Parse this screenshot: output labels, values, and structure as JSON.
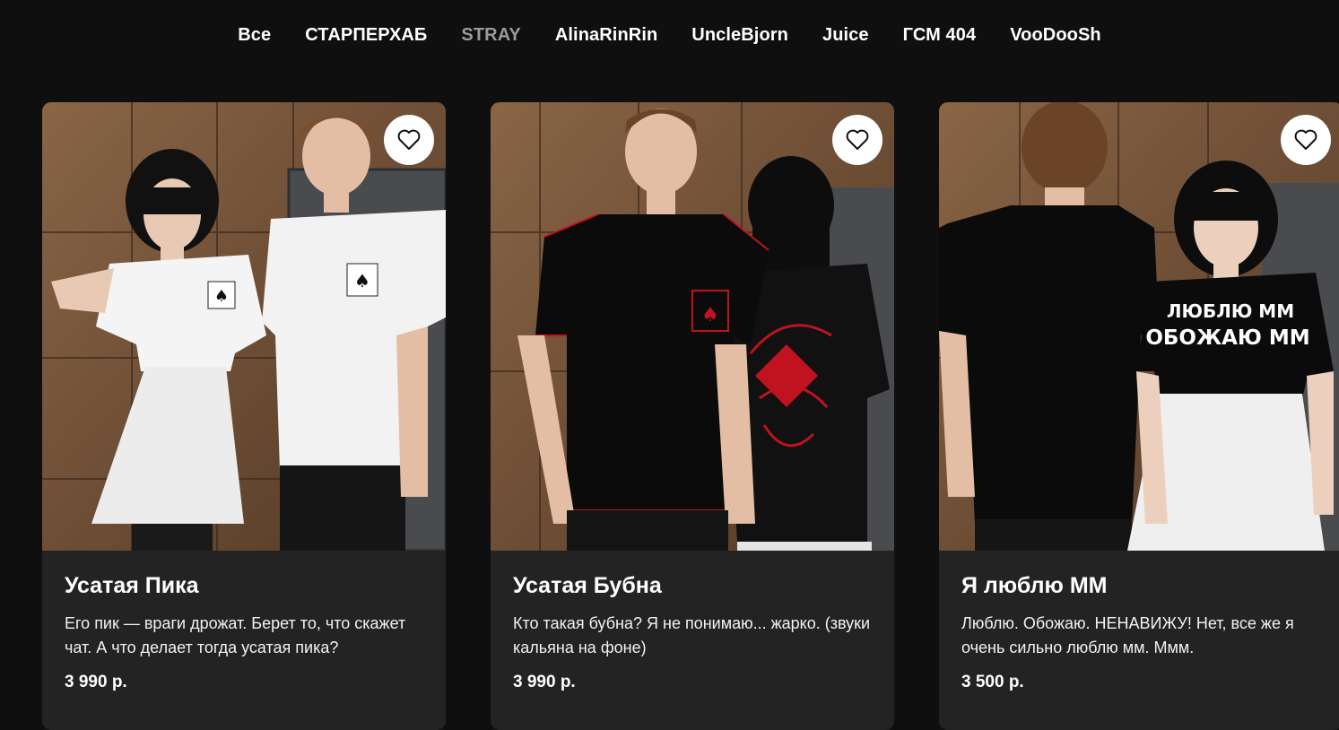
{
  "nav": {
    "items": [
      {
        "label": "Все"
      },
      {
        "label": "СТАРПЕРХАБ"
      },
      {
        "label": "STRAY",
        "active": true
      },
      {
        "label": "AlinaRinRin"
      },
      {
        "label": "UncleBjorn"
      },
      {
        "label": "Juice"
      },
      {
        "label": "ГСМ 404"
      },
      {
        "label": "VooDooSh"
      }
    ]
  },
  "colors": {
    "background": "#0f0f10",
    "card": "#232323",
    "active_nav": "#9b9b9b"
  },
  "products": [
    {
      "title": "Усатая Пика",
      "description": "Его пик — враги дрожат. Берет то, что скажет чат. А что делает тогда усатая пика?",
      "price": "3 990 р.",
      "favorite_icon": "heart-icon"
    },
    {
      "title": "Усатая Бубна",
      "description": "Кто такая бубна? Я не понимаю... жарко. (звуки кальяна на фоне)",
      "price": "3 990 р.",
      "favorite_icon": "heart-icon"
    },
    {
      "title": "Я люблю ММ",
      "description": "Люблю. Обожаю. НЕНАВИЖУ! Нет, все же я очень сильно люблю мм. Ммм.",
      "price": "3 500 р.",
      "favorite_icon": "heart-icon",
      "shirt_print_lines": [
        "ЛЮБЛЮ ММ",
        "ОБОЖАЮ ММ"
      ]
    }
  ]
}
